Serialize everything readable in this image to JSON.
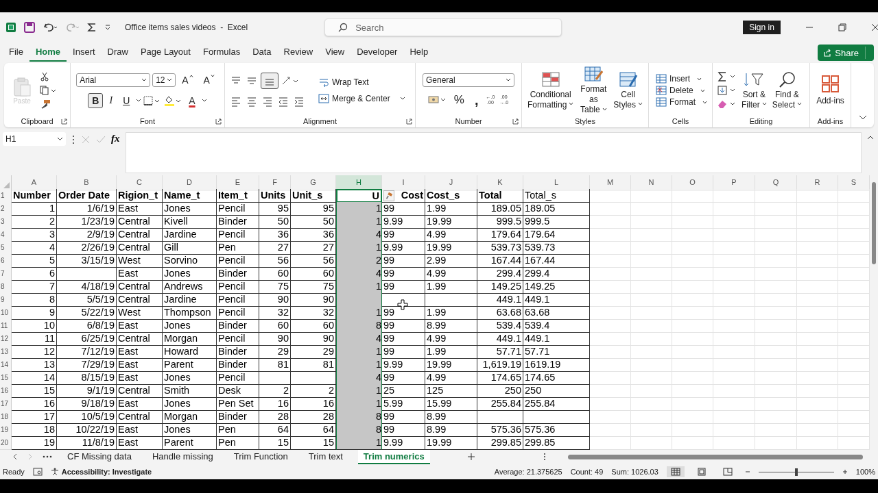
{
  "title_bar": {
    "title": "Office items sales videos  -  Excel",
    "search_placeholder": "Search",
    "sign_in": "Sign in"
  },
  "menu_tabs": [
    {
      "label": "File",
      "selected": false
    },
    {
      "label": "Home",
      "selected": true
    },
    {
      "label": "Insert",
      "selected": false
    },
    {
      "label": "Draw",
      "selected": false
    },
    {
      "label": "Page Layout",
      "selected": false
    },
    {
      "label": "Formulas",
      "selected": false
    },
    {
      "label": "Data",
      "selected": false
    },
    {
      "label": "Review",
      "selected": false
    },
    {
      "label": "View",
      "selected": false
    },
    {
      "label": "Developer",
      "selected": false
    },
    {
      "label": "Help",
      "selected": false
    }
  ],
  "share": "Share",
  "ribbon": {
    "clipboard": {
      "label": "Clipboard",
      "paste": "Paste",
      "paste_disabled": true
    },
    "font": {
      "label": "Font",
      "font_name": "Arial",
      "font_size": "12",
      "grow": "A",
      "shrink": "A",
      "bold": "B",
      "bold_on": true,
      "italic": "I",
      "underline": "U",
      "color_letter": "A"
    },
    "alignment": {
      "label": "Alignment",
      "bottom_align_on": true,
      "wrap_text": "Wrap Text",
      "merge": "Merge & Center"
    },
    "number": {
      "label": "Number",
      "format": "General",
      "percent": "%",
      "comma": ",",
      "decimals": [
        {
          "top": "←.0",
          "bottom": ".00"
        },
        {
          "top": ".00",
          "bottom": "→.0"
        }
      ]
    },
    "styles": {
      "label": "Styles",
      "buttons": [
        {
          "line1": "Conditional",
          "line2": "Formatting"
        },
        {
          "line1": "Format as",
          "line2": "Table"
        },
        {
          "line1": "Cell",
          "line2": "Styles"
        }
      ]
    },
    "cells": {
      "label": "Cells",
      "buttons": [
        "Insert",
        "Delete",
        "Format"
      ]
    },
    "editing": {
      "label": "Editing",
      "buttons": [
        {
          "line1": "Sort &",
          "line2": "Filter"
        },
        {
          "line1": "Find &",
          "line2": "Select"
        }
      ]
    },
    "addins": {
      "label": "Add-ins",
      "button": "Add-ins"
    }
  },
  "formula_bar": {
    "name_box": "H1",
    "function_label": "fx"
  },
  "columns": [
    {
      "letter": "A",
      "right_aligned": true,
      "selected": false
    },
    {
      "letter": "B",
      "right_aligned": true,
      "selected": false
    },
    {
      "letter": "C",
      "right_aligned": false,
      "selected": false
    },
    {
      "letter": "D",
      "right_aligned": false,
      "selected": false
    },
    {
      "letter": "E",
      "right_aligned": false,
      "selected": false
    },
    {
      "letter": "F",
      "right_aligned": true,
      "selected": false
    },
    {
      "letter": "G",
      "right_aligned": true,
      "selected": false
    },
    {
      "letter": "H",
      "right_aligned": true,
      "selected": true
    },
    {
      "letter": "I",
      "right_aligned": false,
      "selected": false
    },
    {
      "letter": "J",
      "right_aligned": false,
      "selected": false
    },
    {
      "letter": "K",
      "right_aligned": true,
      "selected": false
    },
    {
      "letter": "L",
      "right_aligned": false,
      "selected": false
    },
    {
      "letter": "M",
      "selected": false
    },
    {
      "letter": "N",
      "selected": false
    },
    {
      "letter": "O",
      "selected": false
    },
    {
      "letter": "P",
      "selected": false
    },
    {
      "letter": "Q",
      "selected": false
    },
    {
      "letter": "R",
      "selected": false
    },
    {
      "letter": "S",
      "selected": false
    }
  ],
  "header_row": {
    "number": "1",
    "cells": [
      {
        "text": "Number",
        "bold": true,
        "right_aligned": false
      },
      {
        "text": "Order Date",
        "bold": true,
        "right_aligned": false
      },
      {
        "text": "Rigion_t",
        "bold": true,
        "right_aligned": false
      },
      {
        "text": "Name_t",
        "bold": true,
        "right_aligned": false
      },
      {
        "text": "Item_t",
        "bold": true,
        "right_aligned": false
      },
      {
        "text": "Units",
        "bold": true,
        "right_aligned": false
      },
      {
        "text": "Unit_s",
        "bold": true,
        "right_aligned": false
      },
      {
        "text": "U",
        "bold": true,
        "right_aligned": true
      },
      {
        "text": "Cost",
        "bold": true,
        "right_aligned": true
      },
      {
        "text": "Cost_s",
        "bold": true,
        "right_aligned": false
      },
      {
        "text": "Total",
        "bold": true,
        "right_aligned": false
      },
      {
        "text": "Total_s",
        "bold": false,
        "right_aligned": false
      }
    ]
  },
  "rows": [
    {
      "number": "2",
      "cells": [
        "1",
        "1/6/19",
        "East",
        "Jones",
        "Pencil",
        "95",
        "95",
        "1",
        "99",
        "1.99",
        "189.05",
        "189.05"
      ]
    },
    {
      "number": "3",
      "cells": [
        "2",
        "1/23/19",
        "Central",
        "Kivell",
        "Binder",
        "50",
        "50",
        "1",
        "9.99",
        "19.99",
        "999.5",
        "999.5"
      ]
    },
    {
      "number": "4",
      "cells": [
        "3",
        "2/9/19",
        "Central",
        "Jardine",
        "Pencil",
        "36",
        "36",
        "4",
        "99",
        "4.99",
        "179.64",
        "179.64"
      ]
    },
    {
      "number": "5",
      "cells": [
        "4",
        "2/26/19",
        "Central",
        "Gill",
        "Pen",
        "27",
        "27",
        "1",
        "9.99",
        "19.99",
        "539.73",
        "539.73"
      ]
    },
    {
      "number": "6",
      "cells": [
        "5",
        "3/15/19",
        "West",
        "Sorvino",
        "Pencil",
        "56",
        "56",
        "2",
        "99",
        "2.99",
        "167.44",
        "167.44"
      ]
    },
    {
      "number": "7",
      "cells": [
        "6",
        null,
        "East",
        "Jones",
        "Binder",
        "60",
        "60",
        "4",
        "99",
        "4.99",
        "299.4",
        "299.4"
      ]
    },
    {
      "number": "8",
      "cells": [
        "7",
        "4/18/19",
        "Central",
        "Andrews",
        "Pencil",
        "75",
        "75",
        "1",
        "99",
        "1.99",
        "149.25",
        "149.25"
      ]
    },
    {
      "number": "9",
      "cells": [
        "8",
        "5/5/19",
        "Central",
        "Jardine",
        "Pencil",
        "90",
        "90",
        null,
        null,
        null,
        "449.1",
        "449.1"
      ]
    },
    {
      "number": "10",
      "cells": [
        "9",
        "5/22/19",
        "West",
        "Thompson",
        "Pencil",
        "32",
        "32",
        "1",
        "99",
        "1.99",
        "63.68",
        "63.68"
      ]
    },
    {
      "number": "11",
      "cells": [
        "10",
        "6/8/19",
        "East",
        "Jones",
        "Binder",
        "60",
        "60",
        "8",
        "99",
        "8.99",
        "539.4",
        "539.4"
      ]
    },
    {
      "number": "12",
      "cells": [
        "11",
        "6/25/19",
        "Central",
        "Morgan",
        "Pencil",
        "90",
        "90",
        "4",
        "99",
        "4.99",
        "449.1",
        "449.1"
      ]
    },
    {
      "number": "13",
      "cells": [
        "12",
        "7/12/19",
        "East",
        "Howard",
        "Binder",
        "29",
        "29",
        "1",
        "99",
        "1.99",
        "57.71",
        "57.71"
      ]
    },
    {
      "number": "14",
      "cells": [
        "13",
        "7/29/19",
        "East",
        "Parent",
        "Binder",
        "81",
        "81",
        "1",
        "9.99",
        "19.99",
        "1,619.19",
        "1619.19"
      ]
    },
    {
      "number": "15",
      "cells": [
        "14",
        "8/15/19",
        "East",
        "Jones",
        "Pencil",
        null,
        null,
        "4",
        "99",
        "4.99",
        "174.65",
        "174.65"
      ]
    },
    {
      "number": "16",
      "cells": [
        "15",
        "9/1/19",
        "Central",
        "Smith",
        "Desk",
        "2",
        "2",
        "1",
        "25",
        "125",
        "250",
        "250"
      ]
    },
    {
      "number": "17",
      "cells": [
        "16",
        "9/18/19",
        "East",
        "Jones",
        "Pen Set",
        "16",
        "16",
        "1",
        "5.99",
        "15.99",
        "255.84",
        "255.84"
      ]
    },
    {
      "number": "18",
      "cells": [
        "17",
        "10/5/19",
        "Central",
        "Morgan",
        "Binder",
        "28",
        "28",
        "8",
        "99",
        "8.99",
        null,
        null
      ]
    },
    {
      "number": "19",
      "cells": [
        "18",
        "10/22/19",
        "East",
        "Jones",
        "Pen",
        "64",
        "64",
        "8",
        "99",
        "8.99",
        "575.36",
        "575.36"
      ]
    },
    {
      "number": "20",
      "cells": [
        "19",
        "11/8/19",
        "East",
        "Parent",
        "Pen",
        "15",
        "15",
        "1",
        "9.99",
        "19.99",
        "299.85",
        "299.85"
      ]
    }
  ],
  "sheet_tabs": [
    {
      "label": "CF Missing data",
      "selected": false
    },
    {
      "label": "Handle missing",
      "selected": false
    },
    {
      "label": "Trim Function",
      "selected": false
    },
    {
      "label": "Trim text",
      "selected": false
    },
    {
      "label": "Trim numerics",
      "selected": true
    }
  ],
  "status_bar": {
    "ready": "Ready",
    "accessibility": "Accessibility: Investigate",
    "average": "Average: 21.375625",
    "count": "Count: 49",
    "sum": "Sum: 1026.03",
    "zoom": "100%",
    "zoom_level": {
      "level": 0.5
    }
  }
}
